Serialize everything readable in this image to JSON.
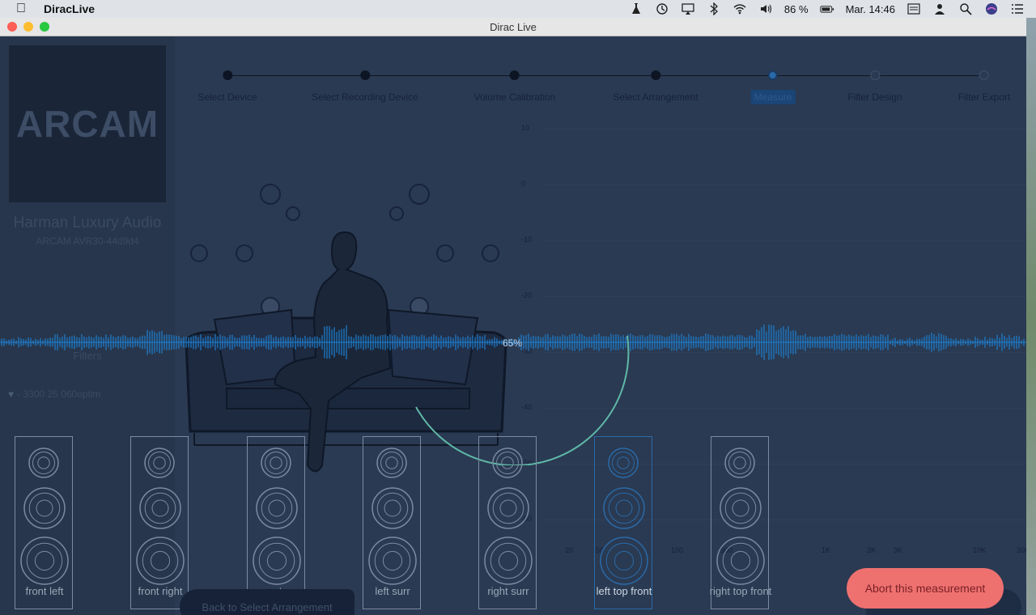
{
  "menubar": {
    "app_name": "DiracLive",
    "battery": "86 %",
    "clock": "Mar. 14:46"
  },
  "window": {
    "title": "Dirac Live"
  },
  "sidebar": {
    "logo": "ARCAM",
    "device_name": "Harman Luxury Audio",
    "device_model": "ARCAM AVR30-44d9d4",
    "filters_label": "Filters",
    "filter_item": "- 3300 25 060optim"
  },
  "stepper": {
    "steps": [
      {
        "label": "Select Device",
        "state": "done"
      },
      {
        "label": "Select Recording Device",
        "state": "done"
      },
      {
        "label": "Volume Calibration",
        "state": "done"
      },
      {
        "label": "Select Arrangement",
        "state": "done"
      },
      {
        "label": "Measure",
        "state": "current"
      },
      {
        "label": "Filter Design",
        "state": "future"
      },
      {
        "label": "Filter Export",
        "state": "future"
      }
    ]
  },
  "graph": {
    "y_ticks": [
      "10",
      "0",
      "-10",
      "-20",
      "-30",
      "-40",
      "-50",
      "-60"
    ],
    "x_ticks": [
      "20",
      "50",
      "100",
      "500",
      "1K",
      "2K",
      "3K",
      "10K",
      "20K"
    ]
  },
  "measurement": {
    "progress_label": "65%",
    "progress": 0.65
  },
  "speakers": [
    {
      "name": "front left",
      "active": false
    },
    {
      "name": "front right",
      "active": false
    },
    {
      "name": "center",
      "active": false
    },
    {
      "name": "left surr",
      "active": false
    },
    {
      "name": "right surr",
      "active": false
    },
    {
      "name": "left top front",
      "active": true
    },
    {
      "name": "right top front",
      "active": false
    }
  ],
  "buttons": {
    "back": "Back to Select Arrangement",
    "abort": "Abort this measurement"
  },
  "colors": {
    "accent": "#2a6aa8",
    "abort": "#ee7170",
    "progress_arc": "#5fb8a8",
    "waveform": "#1e7fd0"
  }
}
